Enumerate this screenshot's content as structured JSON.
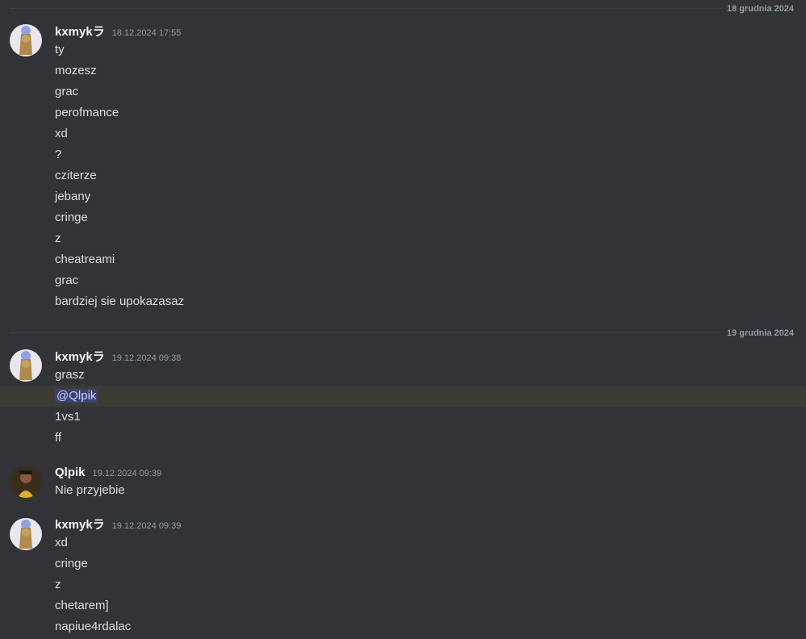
{
  "dates": {
    "first": "18 grudnia 2024",
    "second": "19 grudnia 2024"
  },
  "groups": [
    {
      "author": "kxmykラ",
      "time": "18.12.2024 17:55",
      "lines": [
        "ty",
        "mozesz",
        "grac",
        "perofmance",
        "xd",
        "?",
        "cziterze",
        "jebany",
        "cringe",
        "z",
        "cheatreami",
        "grac",
        "bardziej sie upokazasaz"
      ]
    },
    {
      "author": "kxmykラ",
      "time": "19.12.2024 09:38",
      "lines": [
        "grasz",
        "@Qlpik",
        "1vs1",
        "ff"
      ]
    },
    {
      "author": "Qlpik",
      "time": "19.12.2024 09:39",
      "lines": [
        "Nie przyjebie"
      ]
    },
    {
      "author": "kxmykラ",
      "time": "19.12.2024 09:39",
      "lines": [
        "xd",
        "cringe",
        "z",
        "chetarem]",
        "napiue4rdalac"
      ]
    }
  ],
  "colors": {
    "background": "#313338",
    "mention_highlight": "#3b3a33",
    "mention_pill": "#3c4270"
  }
}
